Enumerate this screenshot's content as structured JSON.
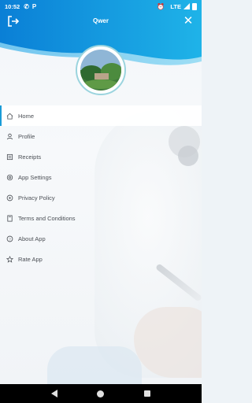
{
  "status_bar": {
    "time": "10:52",
    "network": "LTE",
    "icons": [
      "whatsapp-icon",
      "parking-icon",
      "alarm-icon",
      "signal-icon",
      "battery-icon"
    ]
  },
  "header": {
    "title": "Qwer",
    "left_icon": "logout-icon",
    "right_icon": "close-icon",
    "gradient_colors": [
      "#0a7fd6",
      "#1fb3e8"
    ]
  },
  "avatar": {
    "icon": "profile-photo"
  },
  "menu": {
    "active_color": "#1a9bd7",
    "items": [
      {
        "label": "Home",
        "icon": "home-icon",
        "active": true
      },
      {
        "label": "Profile",
        "icon": "person-icon",
        "active": false
      },
      {
        "label": "Receipts",
        "icon": "receipt-icon",
        "active": false
      },
      {
        "label": "App Settings",
        "icon": "gear-icon",
        "active": false
      },
      {
        "label": "Privacy Policy",
        "icon": "privacy-icon",
        "active": false
      },
      {
        "label": "Terms and Conditions",
        "icon": "document-icon",
        "active": false
      },
      {
        "label": "About App",
        "icon": "help-icon",
        "active": false
      },
      {
        "label": "Rate App",
        "icon": "star-icon",
        "active": false
      }
    ]
  },
  "nav_bar": {
    "buttons": [
      "back",
      "home",
      "recents"
    ]
  }
}
